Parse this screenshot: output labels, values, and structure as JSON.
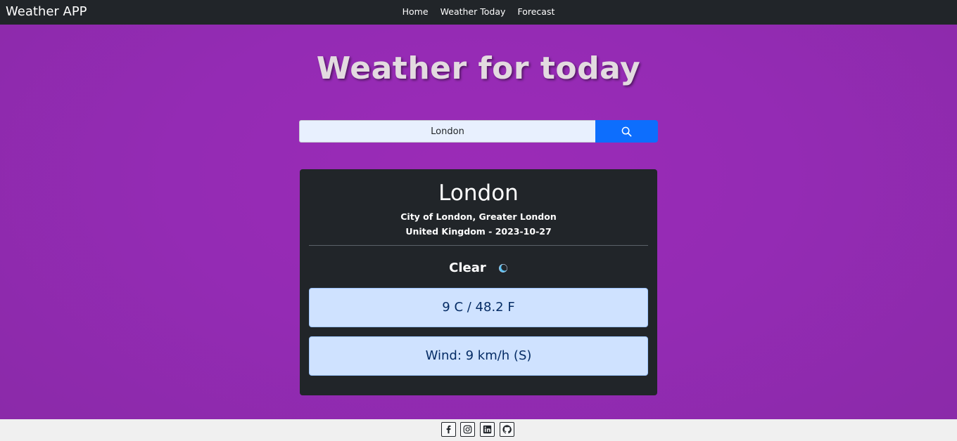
{
  "navbar": {
    "brand": "Weather APP",
    "links": [
      "Home",
      "Weather Today",
      "Forecast"
    ]
  },
  "page": {
    "heading": "Weather for today"
  },
  "search": {
    "value": "London",
    "button_icon": "search-icon"
  },
  "weather": {
    "city": "London",
    "region": "City of London, Greater London",
    "country_date": "United Kingdom - 2023-10-27",
    "condition": "Clear",
    "condition_icon": "moon-icon",
    "temperature": "9 C / 48.2 F",
    "wind": "Wind: 9 km/h (S)"
  },
  "footer": {
    "socials": [
      "facebook-icon",
      "instagram-icon",
      "linkedin-icon",
      "github-icon"
    ]
  },
  "colors": {
    "background": "#942bb4",
    "navbar": "#212529",
    "card": "#212529",
    "accent": "#0d6efd",
    "info_box": "#cfe2ff",
    "info_text": "#052c65"
  }
}
